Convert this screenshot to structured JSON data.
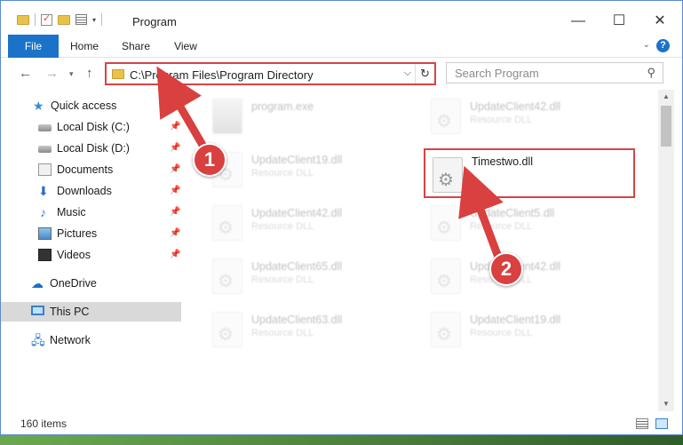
{
  "window": {
    "title": "Program",
    "controls": {
      "minimize": "—",
      "maximize": "☐",
      "close": "✕"
    }
  },
  "ribbon": {
    "tabs": [
      "File",
      "Home",
      "Share",
      "View"
    ],
    "help": "?"
  },
  "nav": {
    "address": "C:\\Program Files\\Program Directory",
    "search_placeholder": "Search Program"
  },
  "sidebar": {
    "items": [
      {
        "label": "Quick access",
        "icon": "star-icon",
        "pinned": false
      },
      {
        "label": "Local Disk (C:)",
        "icon": "disk-icon",
        "pinned": true
      },
      {
        "label": "Local Disk (D:)",
        "icon": "disk-icon",
        "pinned": true
      },
      {
        "label": "Documents",
        "icon": "documents-icon",
        "pinned": true
      },
      {
        "label": "Downloads",
        "icon": "download-icon",
        "pinned": true
      },
      {
        "label": "Music",
        "icon": "music-icon",
        "pinned": true
      },
      {
        "label": "Pictures",
        "icon": "pictures-icon",
        "pinned": true
      },
      {
        "label": "Videos",
        "icon": "video-icon",
        "pinned": true
      },
      {
        "label": "OneDrive",
        "icon": "cloud-icon",
        "pinned": false
      },
      {
        "label": "This PC",
        "icon": "computer-icon",
        "pinned": false,
        "selected": true
      },
      {
        "label": "Network",
        "icon": "network-icon",
        "pinned": false
      }
    ]
  },
  "files": [
    {
      "name": "program.exe",
      "type": "",
      "faded": true
    },
    {
      "name": "UpdateClient42.dll",
      "type": "Resource DLL",
      "faded": true
    },
    {
      "name": "UpdateClient19.dll",
      "type": "Resource DLL",
      "faded": true
    },
    {
      "name": "Timestwo.dll",
      "type": "",
      "faded": false,
      "highlighted": true
    },
    {
      "name": "UpdateClient42.dll",
      "type": "Resource DLL",
      "faded": true
    },
    {
      "name": "UpdateClient5.dll",
      "type": "Resource DLL",
      "faded": true
    },
    {
      "name": "UpdateClient65.dll",
      "type": "Resource DLL",
      "faded": true
    },
    {
      "name": "UpdateClient42.dll",
      "type": "Resource DLL",
      "faded": true
    },
    {
      "name": "UpdateClient63.dll",
      "type": "Resource DLL",
      "faded": true
    },
    {
      "name": "UpdateClient19.dll",
      "type": "Resource DLL",
      "faded": true
    }
  ],
  "status": {
    "count": "160 items"
  },
  "annotations": {
    "step1": "1",
    "step2": "2",
    "color": "#d94040"
  }
}
